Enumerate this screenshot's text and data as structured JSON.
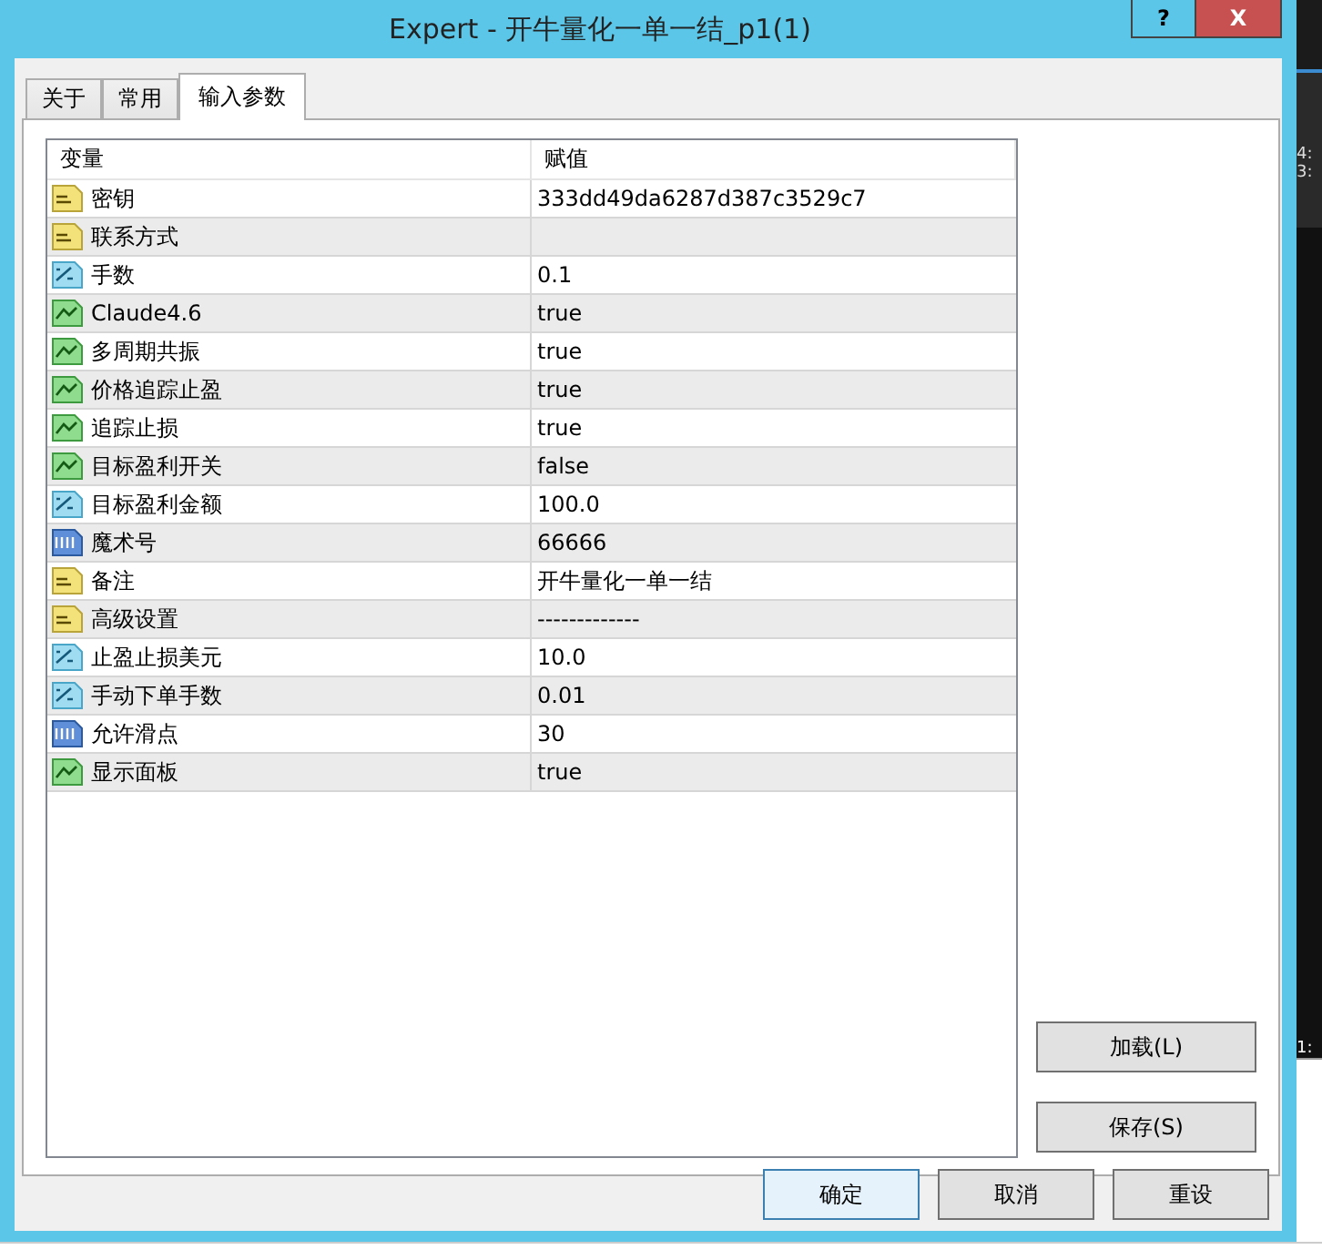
{
  "window": {
    "title": "Expert - 开牛量化一单一结_p1(1)",
    "help_button": "?",
    "close_button": "X"
  },
  "tabs": [
    {
      "label": "关于",
      "selected": false
    },
    {
      "label": "常用",
      "selected": false
    },
    {
      "label": "输入参数",
      "selected": true
    }
  ],
  "table": {
    "columns": [
      "变量",
      "赋值"
    ],
    "rows": [
      {
        "kind": "string",
        "name": "密钥",
        "value": "333dd49da6287d387c3529c7"
      },
      {
        "kind": "string",
        "name": "联系方式",
        "value": ""
      },
      {
        "kind": "double",
        "name": "手数",
        "value": "0.1"
      },
      {
        "kind": "bool",
        "name": "Claude4.6",
        "value": "true"
      },
      {
        "kind": "bool",
        "name": "多周期共振",
        "value": "true"
      },
      {
        "kind": "bool",
        "name": "价格追踪止盈",
        "value": "true"
      },
      {
        "kind": "bool",
        "name": "追踪止损",
        "value": "true"
      },
      {
        "kind": "bool",
        "name": "目标盈利开关",
        "value": "false"
      },
      {
        "kind": "double",
        "name": "目标盈利金额",
        "value": "100.0"
      },
      {
        "kind": "int",
        "name": "魔术号",
        "value": "66666"
      },
      {
        "kind": "string",
        "name": "备注",
        "value": "开牛量化一单一结"
      },
      {
        "kind": "string",
        "name": "高级设置",
        "value": "-------------"
      },
      {
        "kind": "double",
        "name": "止盈止损美元",
        "value": "10.0"
      },
      {
        "kind": "double",
        "name": "手动下单手数",
        "value": "0.01"
      },
      {
        "kind": "int",
        "name": "允许滑点",
        "value": "30"
      },
      {
        "kind": "bool",
        "name": "显示面板",
        "value": "true"
      }
    ]
  },
  "side_buttons": [
    "加载(L)",
    "保存(S)"
  ],
  "buttons": [
    {
      "label": "确定",
      "default": true
    },
    {
      "label": "取消",
      "default": false
    },
    {
      "label": "重设",
      "default": false
    }
  ],
  "background_app": {
    "labels": [
      "4:",
      "3:",
      "1:"
    ]
  }
}
